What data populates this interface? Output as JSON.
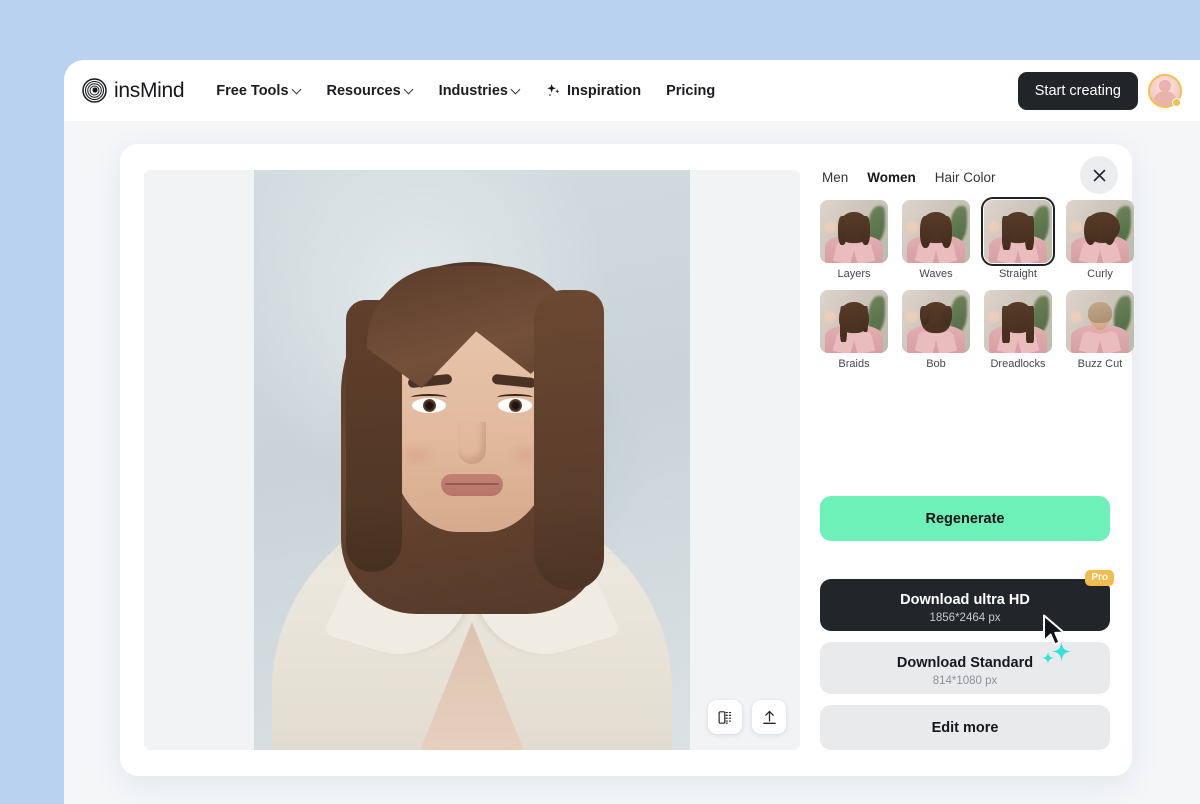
{
  "page": {
    "background_color": "#b9d2ef"
  },
  "navbar": {
    "logo_text": "insMind",
    "logo_icon": "concentric-circles-logo",
    "items": [
      {
        "label": "Free Tools",
        "has_caret": true,
        "icon": null
      },
      {
        "label": "Resources",
        "has_caret": true,
        "icon": null
      },
      {
        "label": "Industries",
        "has_caret": true,
        "icon": null
      },
      {
        "label": "Inspiration",
        "has_caret": false,
        "icon": "sparkle-icon"
      },
      {
        "label": "Pricing",
        "has_caret": false,
        "icon": null
      }
    ],
    "cta_label": "Start creating",
    "cta_bg": "#212429",
    "avatar_ring_color": "#f2c14b"
  },
  "modal": {
    "close_icon": "close-icon"
  },
  "preview": {
    "tools": [
      {
        "name": "compare-split-icon",
        "label": "Compare"
      },
      {
        "name": "upload-arrow-icon",
        "label": "Upload"
      }
    ]
  },
  "panel": {
    "tabs": [
      {
        "label": "Men",
        "active": false
      },
      {
        "label": "Women",
        "active": true
      },
      {
        "label": "Hair Color",
        "active": false
      }
    ],
    "styles": [
      {
        "label": "Layers",
        "variant": "v-layers",
        "selected": false
      },
      {
        "label": "Waves",
        "variant": "v-waves",
        "selected": false
      },
      {
        "label": "Straight",
        "variant": "v-straight",
        "selected": true
      },
      {
        "label": "Curly",
        "variant": "v-curly",
        "selected": false
      },
      {
        "label": "Braids",
        "variant": "v-braids",
        "selected": false
      },
      {
        "label": "Bob",
        "variant": "v-bob",
        "selected": false
      },
      {
        "label": "Dreadlocks",
        "variant": "v-dreadlocks",
        "selected": false
      },
      {
        "label": "Buzz Cut",
        "variant": "v-buzz",
        "selected": false
      }
    ],
    "regenerate_label": "Regenerate",
    "regenerate_color": "#6ef0b9",
    "download_hd": {
      "title": "Download ultra HD",
      "subtitle": "1856*2464 px",
      "badge": "Pro",
      "badge_color": "#f0bd4e"
    },
    "download_standard": {
      "title": "Download Standard",
      "subtitle": "814*1080 px"
    },
    "edit_more_label": "Edit more"
  },
  "overlay": {
    "cursor_icon": "mouse-pointer-arrow",
    "sparkle_color": "#2fe3d8"
  }
}
